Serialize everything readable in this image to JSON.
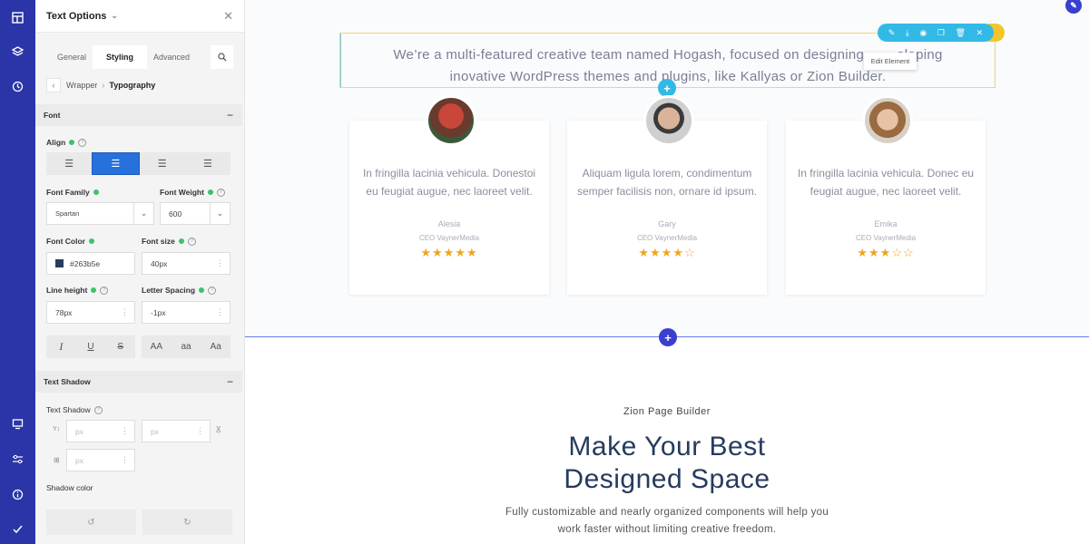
{
  "panel": {
    "title": "Text Options",
    "tabs": [
      "General",
      "Styling",
      "Advanced"
    ],
    "breadcrumb": {
      "parent": "Wrapper",
      "current": "Typography"
    },
    "font_section": "Font",
    "align_label": "Align",
    "font_family_label": "Font Family",
    "font_family_value": "Spartan",
    "font_weight_label": "Font Weight",
    "font_weight_value": "600",
    "font_color_label": "Font Color",
    "font_color_value": "#263b5e",
    "font_size_label": "Font size",
    "font_size_value": "40px",
    "line_height_label": "Line height",
    "line_height_value": "78px",
    "letter_spacing_label": "Letter Spacing",
    "letter_spacing_value": "-1px",
    "case_buttons": [
      "AA",
      "aa",
      "Aa"
    ],
    "text_shadow_section": "Text Shadow",
    "text_shadow_label": "Text Shadow",
    "px_placeholder": "px",
    "shadow_color_label": "Shadow color"
  },
  "canvas": {
    "quote_line1": "We’re a multi-featured creative team named Hogash, focused on designing",
    "quote_line1_tail": "eloping",
    "quote_line2": "inovative WordPress themes and plugins, like Kallyas or Zion Builder.",
    "tooltip": "Edit Element",
    "cards": [
      {
        "text": "In fringilla lacinia vehicula. Donestoi eu feugiat augue, nec laoreet velit.",
        "name": "Alesia",
        "role": "CEO VaynerMedia",
        "stars": "★★★★★"
      },
      {
        "text": "Aliquam ligula lorem, condimentum semper facilisis non, ornare id ipsum.",
        "name": "Gary",
        "role": "CEO VaynerMedia",
        "stars": "★★★★☆"
      },
      {
        "text": "In fringilla lacinia vehicula. Donec eu feugiat augue, nec laoreet velit.",
        "name": "Emika",
        "role": "CEO VaynerMedia",
        "stars": "★★★☆☆"
      }
    ],
    "eyebrow": "Zion Page Builder",
    "headline_1": "Make Your Best",
    "headline_2": "Designed Space",
    "body_1": "Fully customizable and nearly organized components will help you",
    "body_2": "work faster without limiting creative freedom."
  },
  "colors": {
    "rail": "#2b35a8",
    "accent": "#2771dc",
    "toolbar": "#33b9e6",
    "star": "#f0a51f",
    "font_color_swatch": "#263b5e"
  }
}
